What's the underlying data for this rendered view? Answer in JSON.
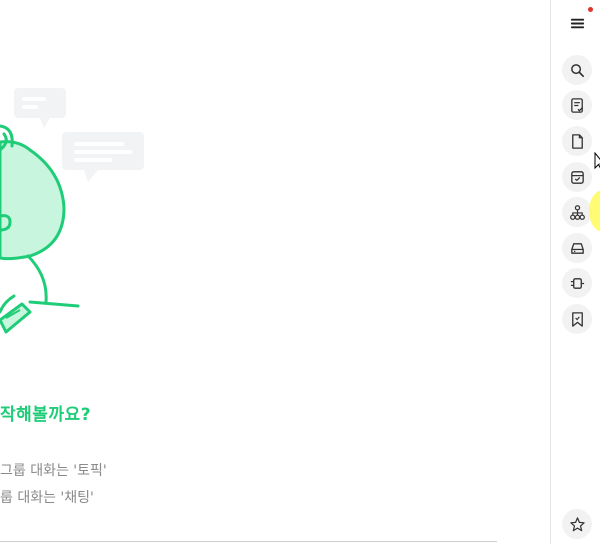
{
  "main": {
    "headline": "작해볼까요?",
    "description": [
      "그룹 대화는 '토픽'",
      "룹 대화는 '채팅'"
    ]
  },
  "rail": {
    "items": [
      {
        "name": "menu",
        "icon": "hamburger-menu-icon",
        "has_badge": true
      },
      {
        "name": "search",
        "icon": "search-icon"
      },
      {
        "name": "tasks",
        "icon": "checklist-icon"
      },
      {
        "name": "files",
        "icon": "file-icon"
      },
      {
        "name": "archive",
        "icon": "archive-box-icon"
      },
      {
        "name": "org-chart",
        "icon": "org-chart-icon"
      },
      {
        "name": "storage",
        "icon": "drive-icon"
      },
      {
        "name": "connector",
        "icon": "plug-connector-icon"
      },
      {
        "name": "bookmarks",
        "icon": "bookmark-icon"
      },
      {
        "name": "favorites",
        "icon": "star-icon"
      }
    ]
  },
  "colors": {
    "accent": "#1fcc77",
    "illustration_fill": "#c8f5dd",
    "badge": "#e0342f",
    "rail_button_bg": "#f2f2f2",
    "muted_text": "#8a8a8a"
  }
}
